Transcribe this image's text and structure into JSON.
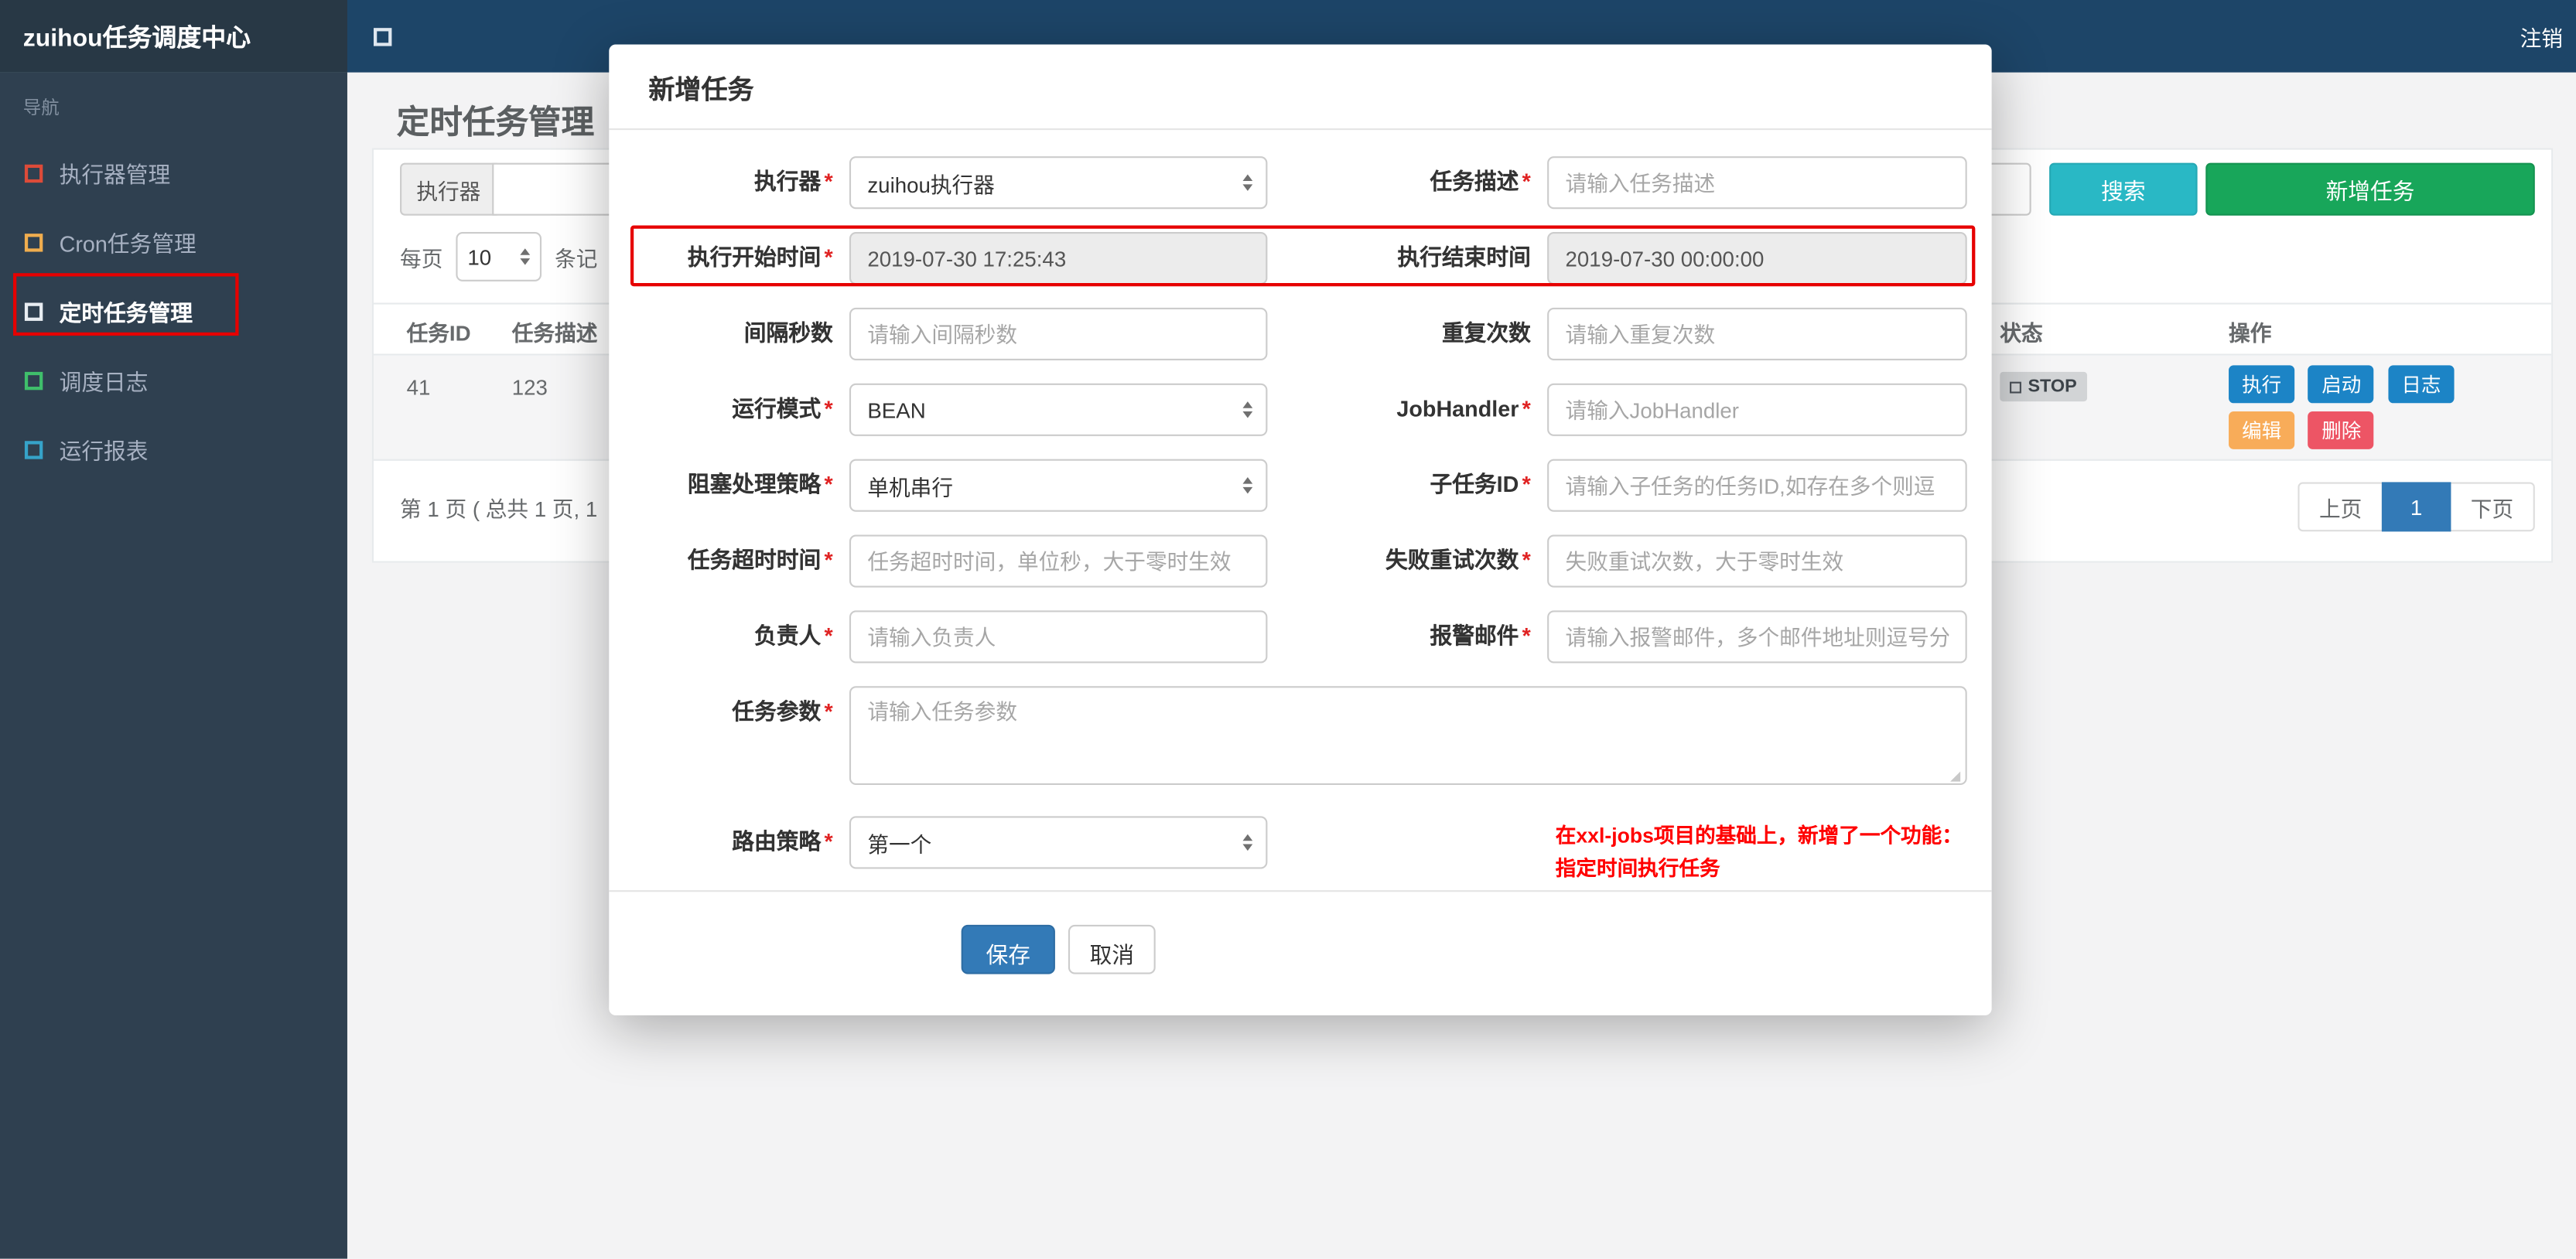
{
  "topbar": {
    "brand": "zuihou任务调度中心",
    "logout": "注销"
  },
  "sidebar": {
    "nav_label": "导航",
    "items": [
      {
        "label": "执行器管理",
        "icon_color": "#dd4b39",
        "active": false
      },
      {
        "label": "Cron任务管理",
        "icon_color": "#f0ad4e",
        "active": false
      },
      {
        "label": "定时任务管理",
        "icon_color": "#e8edf2",
        "active": true
      },
      {
        "label": "调度日志",
        "icon_color": "#3fbf6b",
        "active": false
      },
      {
        "label": "运行报表",
        "icon_color": "#36a3c9",
        "active": false
      }
    ]
  },
  "page": {
    "title": "定时任务管理",
    "filter": {
      "executor_label": "执行器",
      "search_label": "搜索",
      "add_label": "新增任务"
    },
    "per_page": {
      "label_before": "每页",
      "value": "10",
      "label_after": "条记"
    },
    "table": {
      "headers": [
        "任务ID",
        "任务描述",
        "状态",
        "操作"
      ],
      "row": {
        "id": "41",
        "desc": "123",
        "status": "STOP"
      },
      "actions": [
        "执行",
        "启动",
        "日志",
        "编辑",
        "删除"
      ]
    },
    "pagination": {
      "summary": "第 1 页 ( 总共 1 页, 1",
      "prev": "上页",
      "current": "1",
      "next": "下页"
    }
  },
  "modal": {
    "title": "新增任务",
    "required_mark": "*",
    "rows": [
      {
        "left": {
          "label": "执行器",
          "required": true,
          "type": "select",
          "value": "zuihou执行器"
        },
        "right": {
          "label": "任务描述",
          "required": true,
          "type": "input",
          "placeholder": "请输入任务描述"
        }
      },
      {
        "highlighted": true,
        "left": {
          "label": "执行开始时间",
          "required": true,
          "type": "input",
          "readonly": true,
          "value": "2019-07-30 17:25:43"
        },
        "right": {
          "label": "执行结束时间",
          "required": false,
          "type": "input",
          "readonly": true,
          "value": "2019-07-30 00:00:00"
        }
      },
      {
        "left": {
          "label": "间隔秒数",
          "required": false,
          "type": "input",
          "placeholder": "请输入间隔秒数"
        },
        "right": {
          "label": "重复次数",
          "required": false,
          "type": "input",
          "placeholder": "请输入重复次数"
        }
      },
      {
        "left": {
          "label": "运行模式",
          "required": true,
          "type": "select",
          "value": "BEAN"
        },
        "right": {
          "label": "JobHandler",
          "required": true,
          "type": "input",
          "placeholder": "请输入JobHandler"
        }
      },
      {
        "left": {
          "label": "阻塞处理策略",
          "required": true,
          "type": "select",
          "value": "单机串行"
        },
        "right": {
          "label": "子任务ID",
          "required": true,
          "type": "input",
          "placeholder": "请输入子任务的任务ID,如存在多个则逗"
        }
      },
      {
        "left": {
          "label": "任务超时时间",
          "required": true,
          "type": "input",
          "placeholder": "任务超时时间，单位秒，大于零时生效"
        },
        "right": {
          "label": "失败重试次数",
          "required": true,
          "type": "input",
          "placeholder": "失败重试次数，大于零时生效"
        }
      },
      {
        "left": {
          "label": "负责人",
          "required": true,
          "type": "input",
          "placeholder": "请输入负责人"
        },
        "right": {
          "label": "报警邮件",
          "required": true,
          "type": "input",
          "placeholder": "请输入报警邮件，多个邮件地址则逗号分"
        }
      }
    ],
    "params_row": {
      "label": "任务参数",
      "required": true,
      "placeholder": "请输入任务参数"
    },
    "route_row": {
      "label": "路由策略",
      "required": true,
      "type": "select",
      "value": "第一个"
    },
    "note": {
      "line1": "在xxl-jobs项目的基础上，新增了一个功能：",
      "line2": "指定时间执行任务"
    },
    "footer": {
      "save": "保存",
      "cancel": "取消"
    }
  },
  "colors": {
    "topbar": "#1d4568",
    "brand_bg": "#283845",
    "sidebar": "#2f4050",
    "search_button": "#29b8c5",
    "add_button": "#18a65a",
    "action_blue": "#1c84c6",
    "action_orange": "#f8ac59",
    "action_red": "#ed5565",
    "save_button": "#337ab7",
    "active_page": "#337ab7",
    "annotation_red": "#e60000",
    "note_text": "#ff0000",
    "status_badge_bg": "#d2d4d6"
  }
}
